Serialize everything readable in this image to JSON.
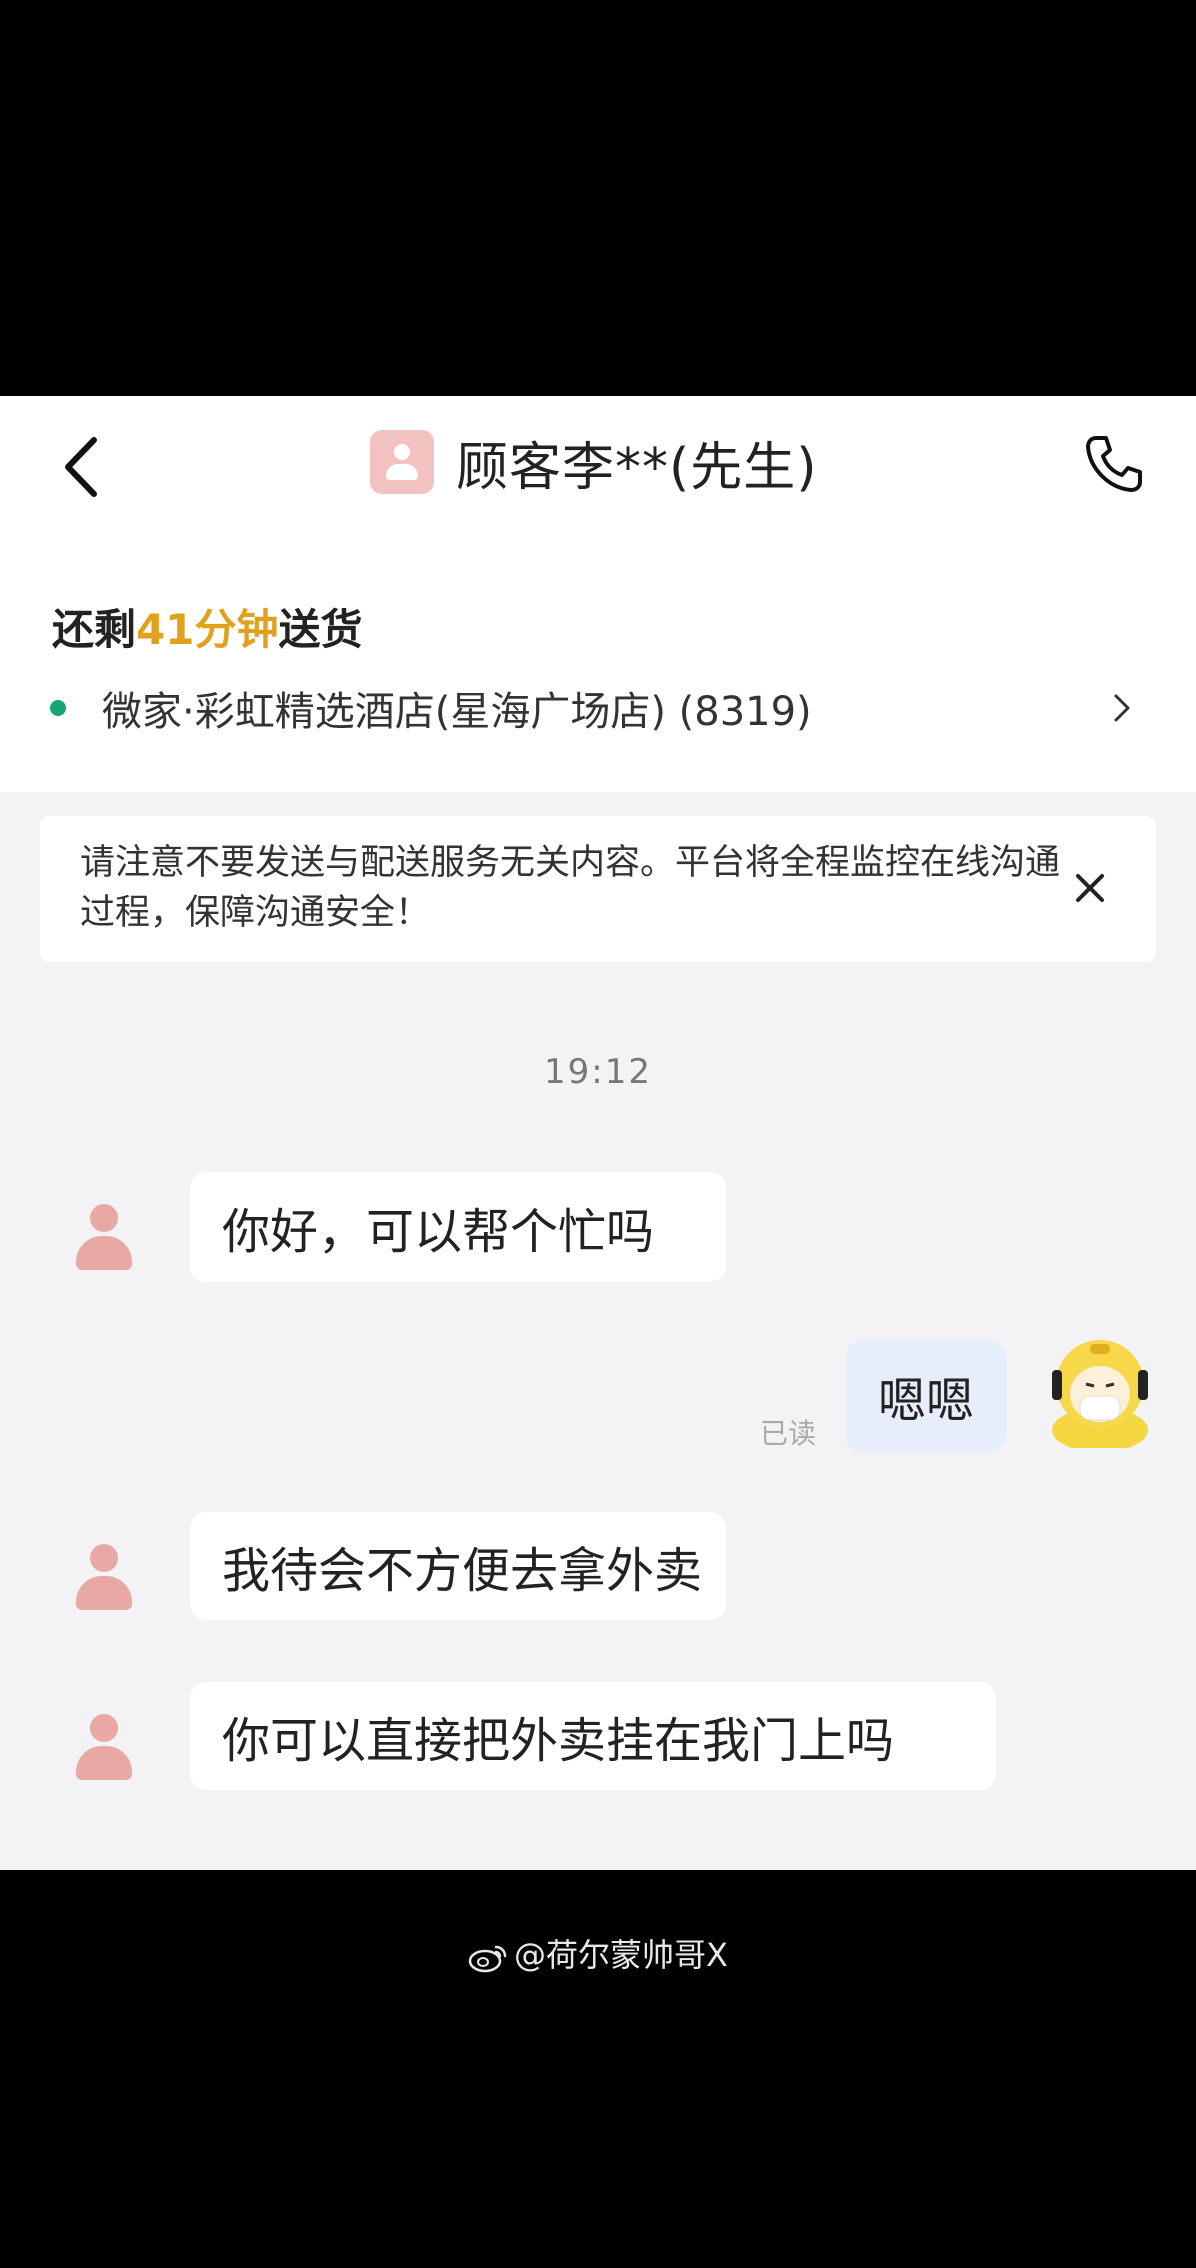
{
  "header": {
    "title": "顾客李**(先生)",
    "remaining_prefix": "还剩",
    "remaining_minutes": "41分钟",
    "remaining_suffix": "送货",
    "store": "微家·彩虹精选酒店(星海广场店) (8319)"
  },
  "notice": {
    "text": "请注意不要发送与配送服务无关内容。平台将全程监控在线沟通过程，保障沟通安全！"
  },
  "chat": {
    "timestamp": "19:12",
    "messages": [
      {
        "from": "customer",
        "text": "你好，可以帮个忙吗"
      },
      {
        "from": "rider",
        "text": "嗯嗯",
        "status": "已读"
      },
      {
        "from": "customer",
        "text": "我待会不方便去拿外卖"
      },
      {
        "from": "customer",
        "text": "你可以直接把外卖挂在我门上吗"
      }
    ]
  },
  "watermark": "@荷尔蒙帅哥X",
  "icons": {
    "back": "chevron-left-icon",
    "phone": "phone-icon",
    "close": "close-icon",
    "store_chevron": "chevron-right-icon",
    "weibo": "weibo-icon"
  },
  "colors": {
    "accent_minutes": "#e0a21c",
    "store_dot": "#1aa472",
    "avatar_pink": "#e8a8a4",
    "self_bubble": "#e6eefb"
  }
}
